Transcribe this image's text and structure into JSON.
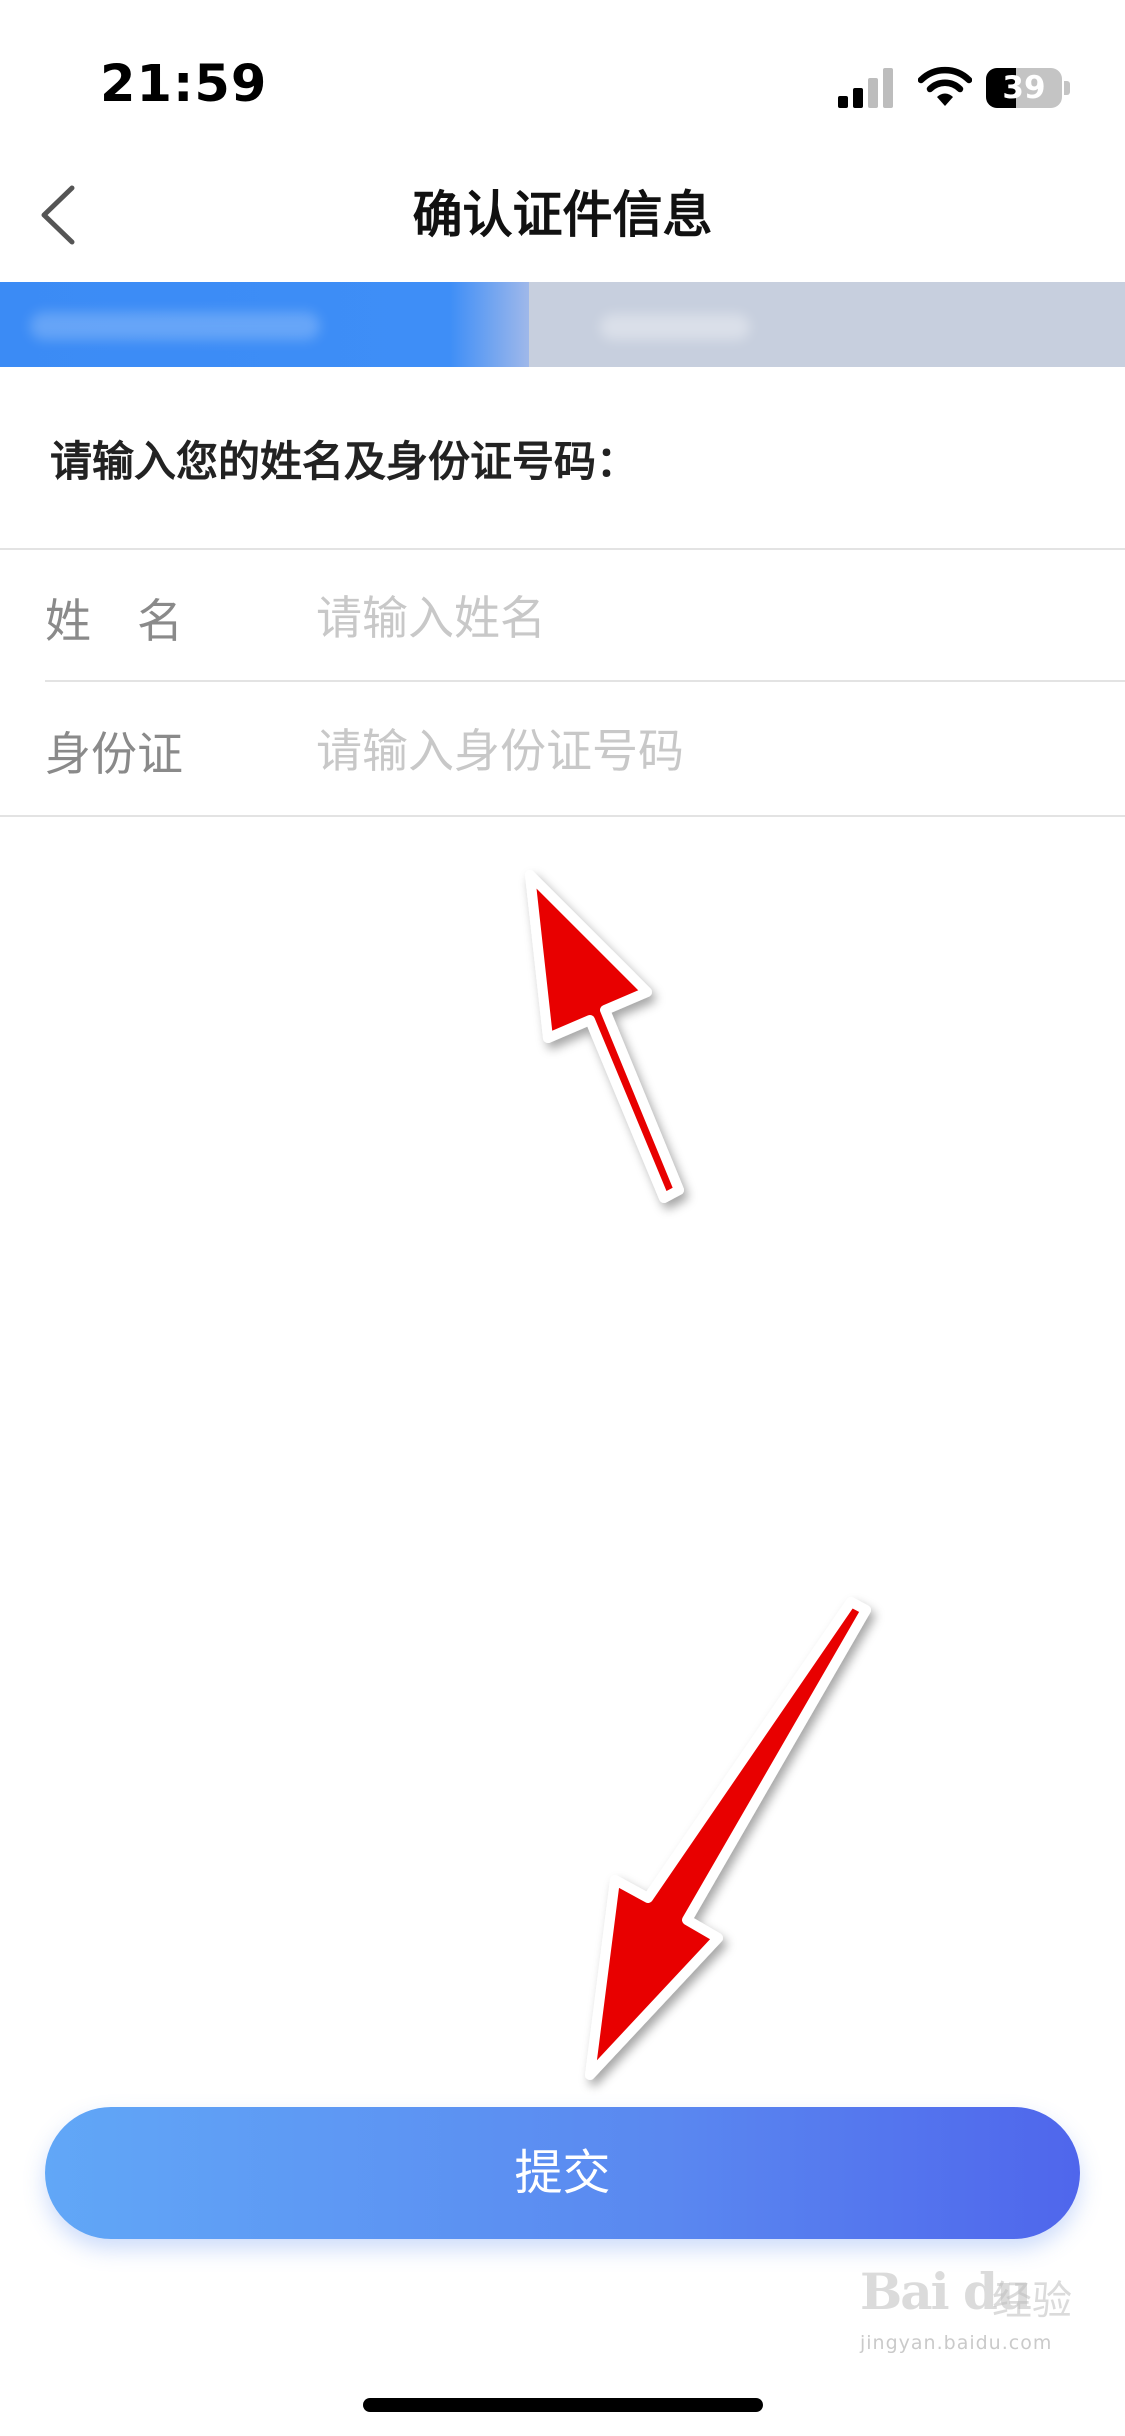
{
  "status_bar": {
    "time": "21:59",
    "battery_level": "39",
    "battery_fraction": 0.39,
    "signal_icon": "cellular-signal-icon",
    "wifi_icon": "wifi-icon"
  },
  "nav": {
    "title": "确认证件信息",
    "back_icon": "chevron-left-icon"
  },
  "progress": {
    "fraction": 0.47,
    "accent_color": "#3e8ef7",
    "track_color": "#c7cfde"
  },
  "form": {
    "instruction": "请输入您的姓名及身份证号码：",
    "name": {
      "label": "姓　名",
      "value": "",
      "placeholder": "请输入姓名"
    },
    "id_card": {
      "label": "身份证",
      "value": "",
      "placeholder": "请输入身份证号码"
    }
  },
  "submit": {
    "label": "提交",
    "gradient_start": "#61a7f7",
    "gradient_end": "#4f66ec"
  },
  "annotations": {
    "arrow_color": "#e80000",
    "arrows": [
      "arrow-to-form-fields",
      "arrow-to-submit-button"
    ]
  },
  "watermark": {
    "logo": "Bai du",
    "text": "经验",
    "url": "jingyan.baidu.com"
  }
}
